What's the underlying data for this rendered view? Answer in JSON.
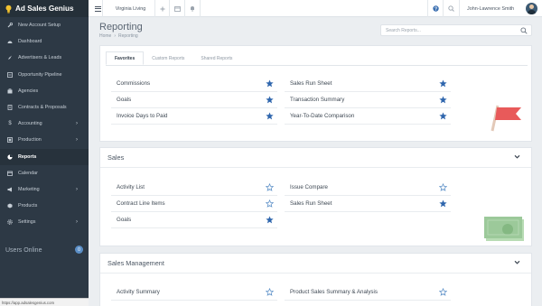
{
  "brand": {
    "name": "Ad Sales Genius"
  },
  "sidebar": {
    "items": [
      {
        "label": "New Account Setup",
        "icon": "wrench-icon"
      },
      {
        "label": "Dashboard",
        "icon": "dashboard-icon"
      },
      {
        "label": "Advertisers & Leads",
        "icon": "rocket-icon"
      },
      {
        "label": "Opportunity Pipeline",
        "icon": "pipeline-icon"
      },
      {
        "label": "Agencies",
        "icon": "agency-icon"
      },
      {
        "label": "Contracts & Proposals",
        "icon": "contract-icon"
      },
      {
        "label": "Accounting",
        "icon": "dollar-icon"
      },
      {
        "label": "Production",
        "icon": "production-icon"
      },
      {
        "label": "Reports",
        "icon": "reports-icon"
      },
      {
        "label": "Calendar",
        "icon": "calendar-icon"
      },
      {
        "label": "Marketing",
        "icon": "megaphone-icon"
      },
      {
        "label": "Products",
        "icon": "products-icon"
      },
      {
        "label": "Settings",
        "icon": "gear-icon"
      }
    ],
    "active": "Reports",
    "users_online": {
      "label": "Users Online",
      "count": "0"
    }
  },
  "status_bar_url": "https://app.adsalesgenius.com",
  "topbar": {
    "publication": "Virginia Living",
    "user_name": "John-Lawrence Smith"
  },
  "page": {
    "title": "Reporting",
    "breadcrumb": [
      "Home",
      "Reporting"
    ],
    "search_placeholder": "Search Reports..."
  },
  "tabs": [
    "Favorites",
    "Custom Reports",
    "Shared Reports"
  ],
  "favorites": {
    "col1": [
      "Commissions",
      "Goals",
      "Invoice Days to Paid"
    ],
    "col2": [
      "Sales Run Sheet",
      "Transaction Summary",
      "Year-To-Date Comparison"
    ]
  },
  "sales": {
    "title": "Sales",
    "col1": [
      {
        "label": "Activity List",
        "starred": false
      },
      {
        "label": "Contract Line Items",
        "starred": false
      },
      {
        "label": "Goals",
        "starred": true
      }
    ],
    "col2": [
      {
        "label": "Issue Compare",
        "starred": false
      },
      {
        "label": "Sales Run Sheet",
        "starred": true
      }
    ]
  },
  "sales_management": {
    "title": "Sales Management",
    "col1": [
      {
        "label": "Activity Summary",
        "starred": false
      }
    ],
    "col2": [
      {
        "label": "Product Sales Summary & Analysis",
        "starred": false
      }
    ]
  },
  "colors": {
    "sidebar_bg": "#2d3945",
    "star_filled": "#2f66ad",
    "star_outline": "#5b8fc7",
    "flag_red": "#e85a5a",
    "money_green": "#9cc99a"
  }
}
